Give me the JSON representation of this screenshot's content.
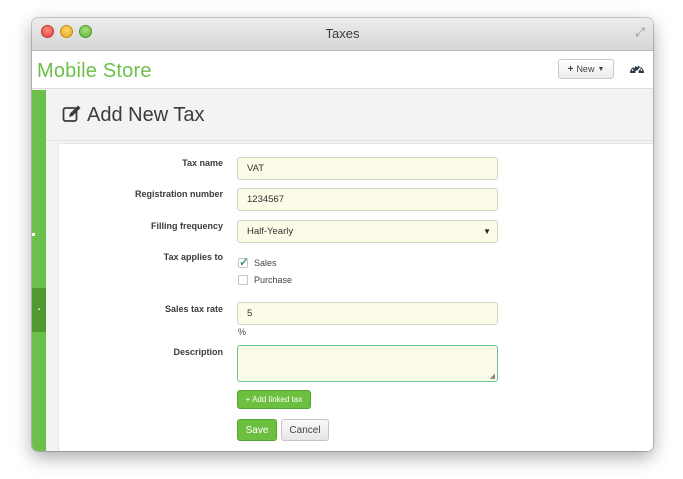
{
  "window": {
    "title": "Taxes"
  },
  "app": {
    "brand": "Mobile Store",
    "new_button": {
      "icon": "plus-icon",
      "label": "New",
      "caret": "chevron-down-icon"
    },
    "dashboard_icon": "dashboard-icon"
  },
  "page": {
    "title": "Add New Tax",
    "icon": "edit-icon"
  },
  "form": {
    "tax_name": {
      "label": "Tax name",
      "value": "VAT"
    },
    "registration_number": {
      "label": "Registration number",
      "value": "1234567"
    },
    "filling_frequency": {
      "label": "Filling frequency",
      "value": "Half-Yearly"
    },
    "tax_applies_to": {
      "label": "Tax applies to",
      "options": [
        {
          "label": "Sales",
          "checked": true
        },
        {
          "label": "Purchase",
          "checked": false
        }
      ]
    },
    "sales_tax_rate": {
      "label": "Sales tax rate",
      "value": "5",
      "unit": "%"
    },
    "description": {
      "label": "Description",
      "value": ""
    },
    "add_linked_tax_label": "+ Add linked tax",
    "save_label": "Save",
    "cancel_label": "Cancel"
  },
  "colors": {
    "accent": "#6cc04a",
    "accent_dark": "#4f9a30",
    "field_bg": "#fbfbe8"
  }
}
